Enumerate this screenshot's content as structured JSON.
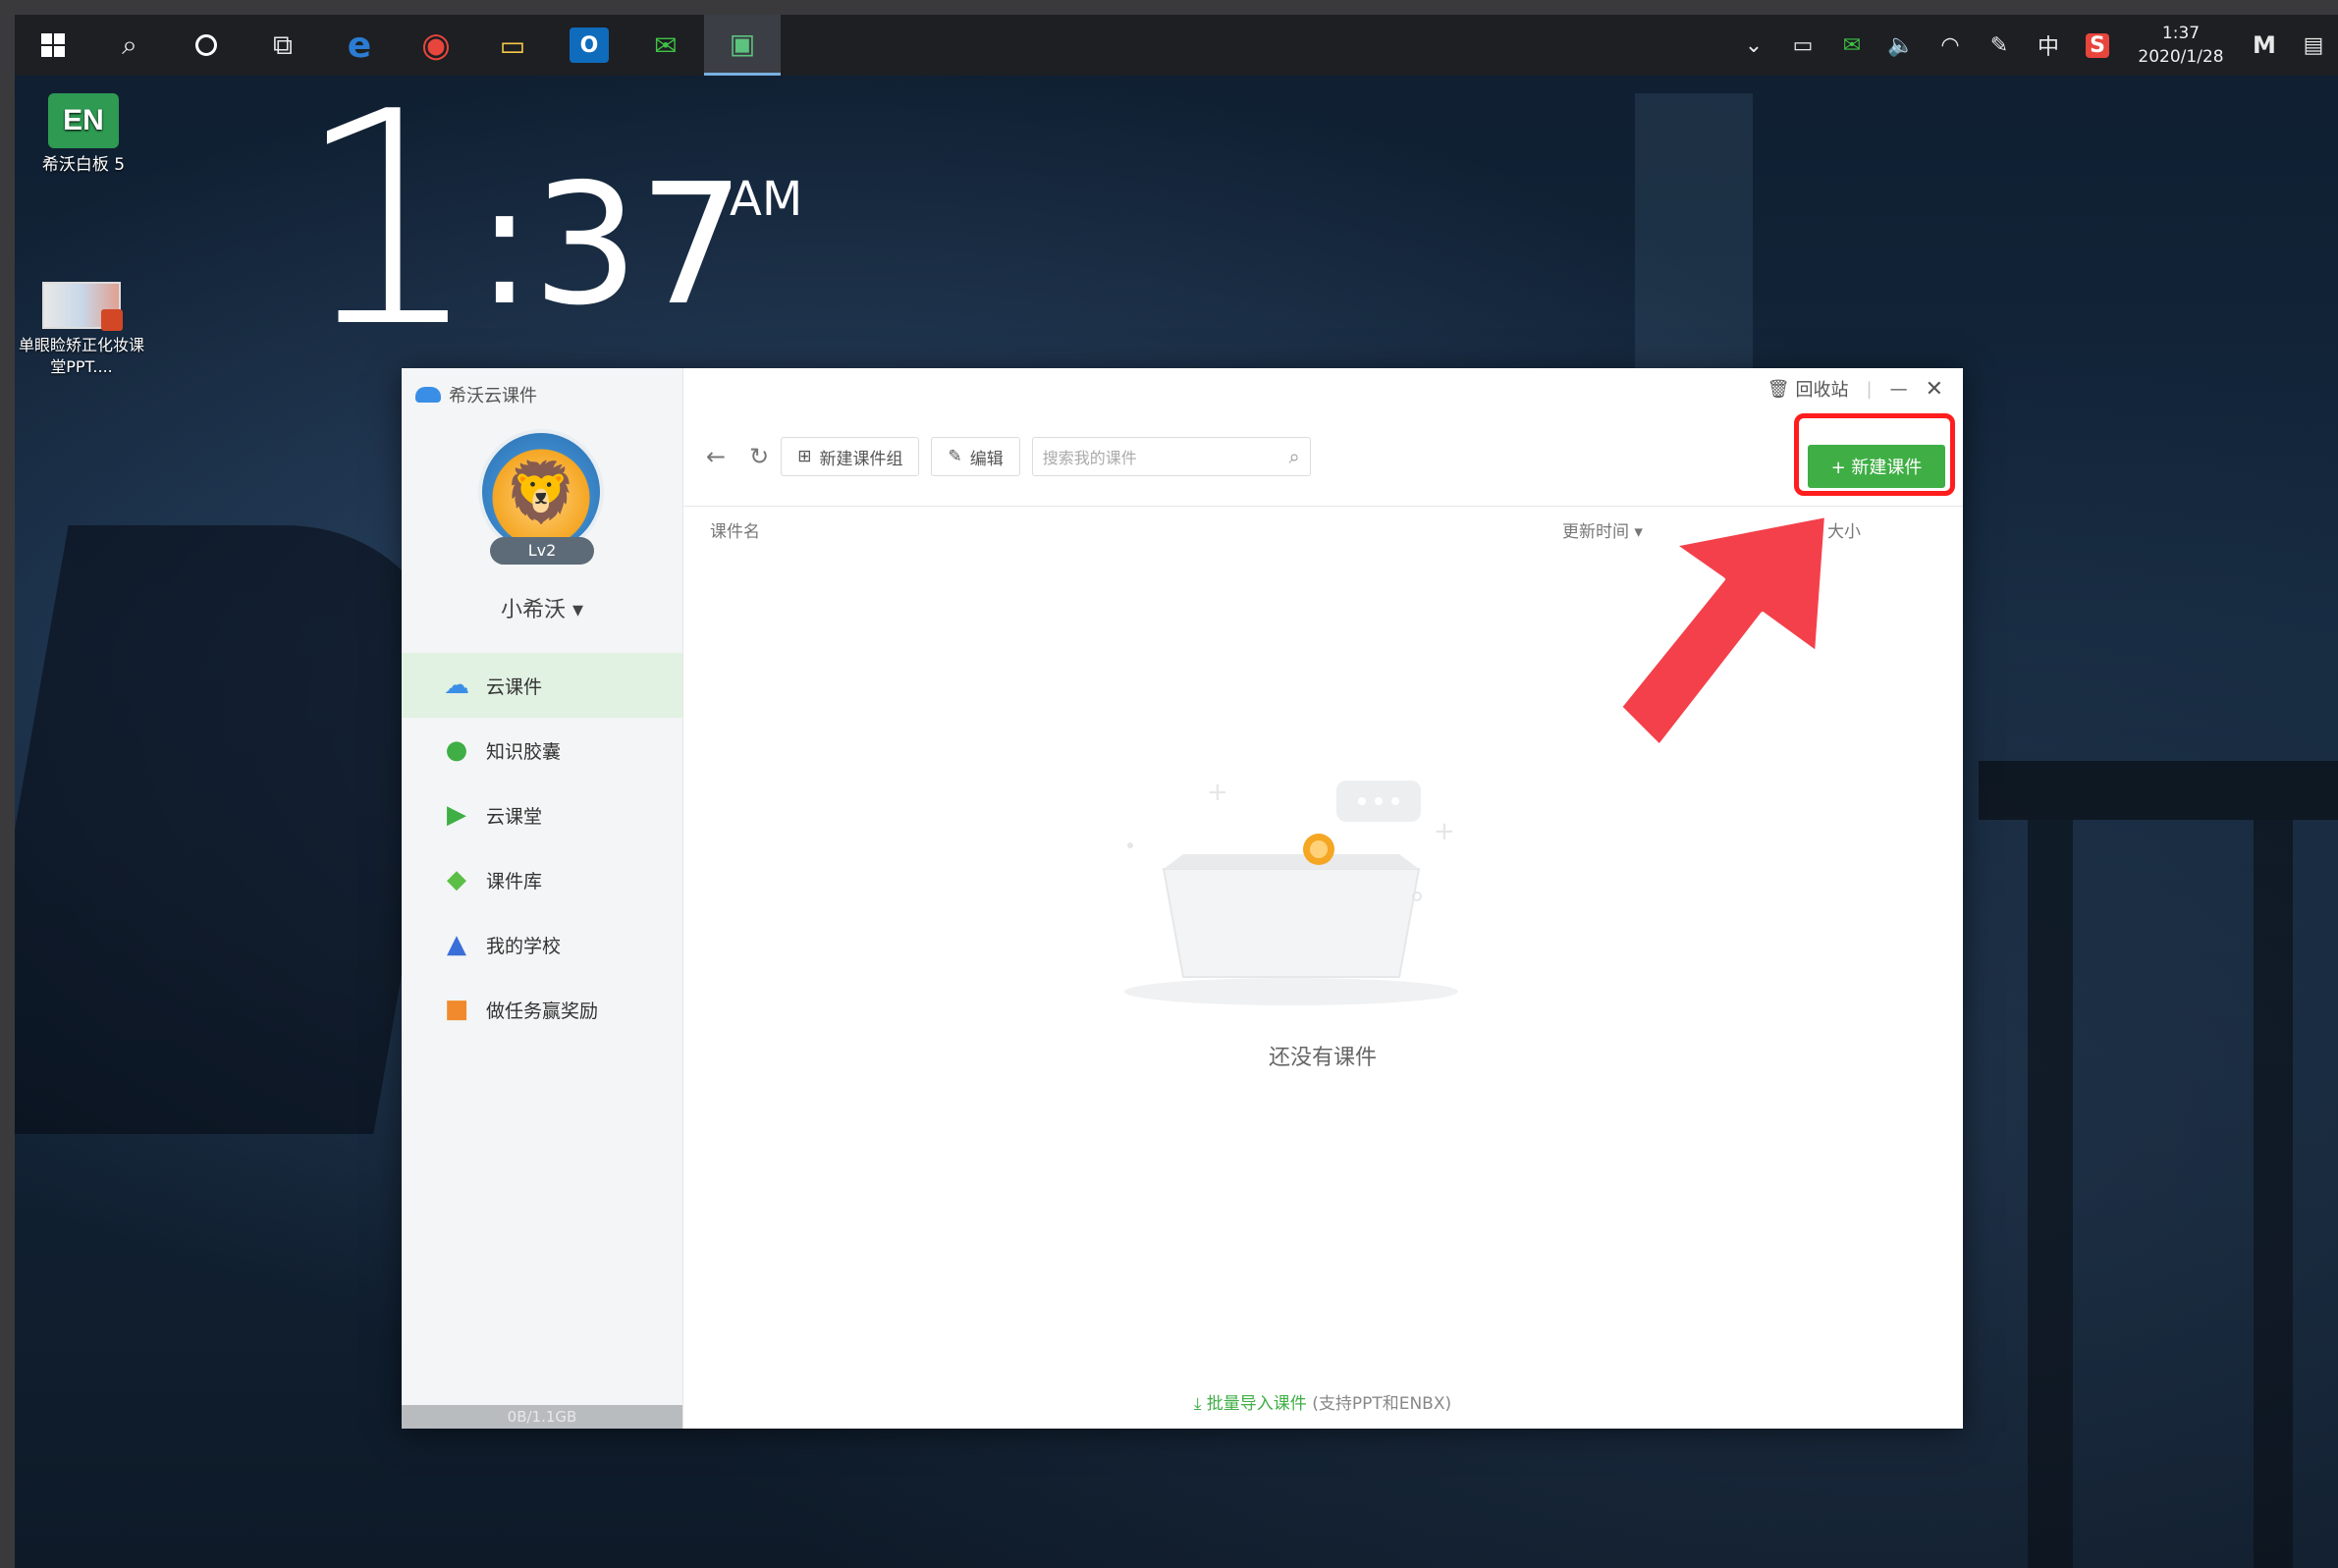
{
  "taskbar": {
    "apps": [
      {
        "name": "windows-start",
        "glyph": ""
      },
      {
        "name": "search",
        "glyph": "⌕"
      },
      {
        "name": "cortana",
        "glyph": ""
      },
      {
        "name": "task-view",
        "glyph": "⧉"
      },
      {
        "name": "edge",
        "glyph": "e"
      },
      {
        "name": "chrome",
        "glyph": "◉"
      },
      {
        "name": "file-explorer",
        "glyph": "▭"
      },
      {
        "name": "outlook",
        "glyph": "O"
      },
      {
        "name": "wechat",
        "glyph": "✉"
      },
      {
        "name": "seewo",
        "glyph": "▣"
      }
    ],
    "tray": {
      "ime": "中",
      "time": "1:37",
      "date": "2020/1/28"
    }
  },
  "desktop": {
    "icons": [
      {
        "logo": "EN",
        "label": "希沃白板 5"
      },
      {
        "label": "单眼睑矫正化妆课堂PPT...."
      }
    ],
    "clock": {
      "hour": "1",
      "minutes": ":37",
      "ampm": "AM"
    }
  },
  "app": {
    "title": "希沃云课件",
    "level": "Lv2",
    "username": "小希沃 ▾",
    "nav": [
      {
        "label": "云课件",
        "icon": "☁",
        "color": "#3a8ee6",
        "active": true
      },
      {
        "label": "知识胶囊",
        "icon": "●",
        "color": "#3fae45",
        "active": false
      },
      {
        "label": "云课堂",
        "icon": "▶",
        "color": "#3fae45",
        "active": false
      },
      {
        "label": "课件库",
        "icon": "◆",
        "color": "#5bbf47",
        "active": false
      },
      {
        "label": "我的学校",
        "icon": "▲",
        "color": "#3a6ed8",
        "active": false
      },
      {
        "label": "做任务赢奖励",
        "icon": "■",
        "color": "#f08a2c",
        "active": false
      }
    ],
    "storage": "0B/1.1GB",
    "recycle": "回收站",
    "toolbar": {
      "new_group": "新建课件组",
      "edit": "编辑",
      "search_placeholder": "搜索我的课件",
      "new_courseware": "+ 新建课件"
    },
    "columns": {
      "name": "课件名",
      "updated": "更新时间 ▾",
      "size": "大小"
    },
    "empty": "还没有课件",
    "import_link": "批量导入课件",
    "import_note": "(支持PPT和ENBX)",
    "colors": {
      "accent": "#3fae45",
      "highlight": "#ff1d1d",
      "arrow": "#f4404a"
    }
  }
}
